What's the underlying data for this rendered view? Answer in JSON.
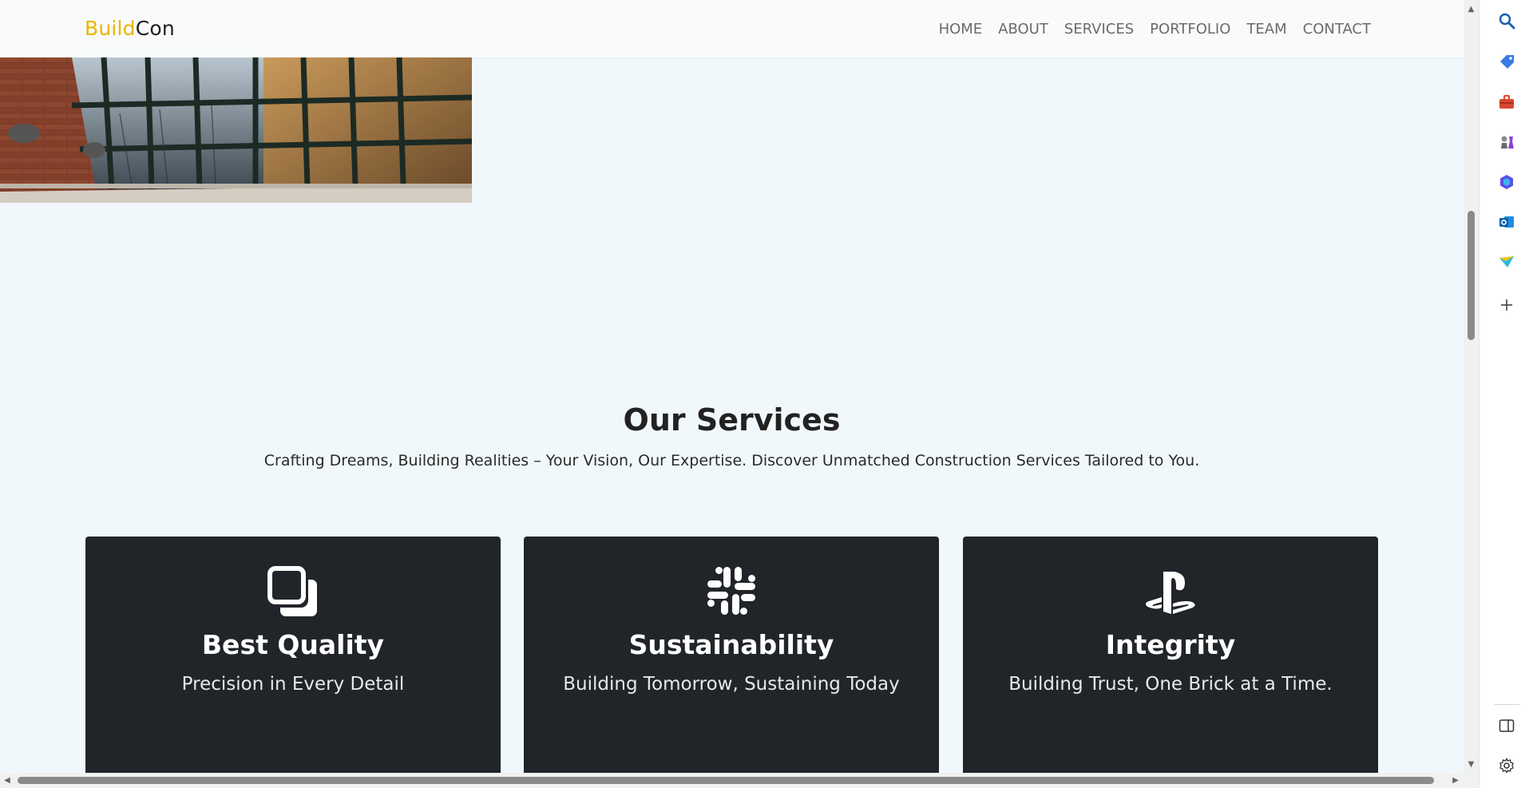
{
  "brand": {
    "part1": "Build",
    "part2": "Con"
  },
  "nav": {
    "home": "HOME",
    "about": "ABOUT",
    "services": "SERVICES",
    "portfolio": "PORTFOLIO",
    "team": "TEAM",
    "contact": "CONTACT"
  },
  "services": {
    "title": "Our Services",
    "subtitle": "Crafting Dreams, Building Realities – Your Vision, Our Expertise. Discover Unmatched Construction Services Tailored to You.",
    "cards": [
      {
        "icon": "copy-squares-icon",
        "title": "Best Quality",
        "subtitle": "Precision in Every Detail"
      },
      {
        "icon": "slack-icon",
        "title": "Sustainability",
        "subtitle": "Building Tomorrow, Sustaining Today"
      },
      {
        "icon": "playstation-icon",
        "title": "Integrity",
        "subtitle": "Building Trust, One Brick at a Time."
      }
    ]
  },
  "sidebar": {
    "icons": [
      "search-icon",
      "tag-icon",
      "briefcase-icon",
      "chess-icon",
      "copilot-icon",
      "outlook-icon",
      "send-icon",
      "add-icon",
      "sidebar-toggle-icon",
      "settings-icon"
    ]
  },
  "colors": {
    "accent": "#e9b500",
    "card_bg": "#212529",
    "page_bg": "#f1f8fc"
  }
}
